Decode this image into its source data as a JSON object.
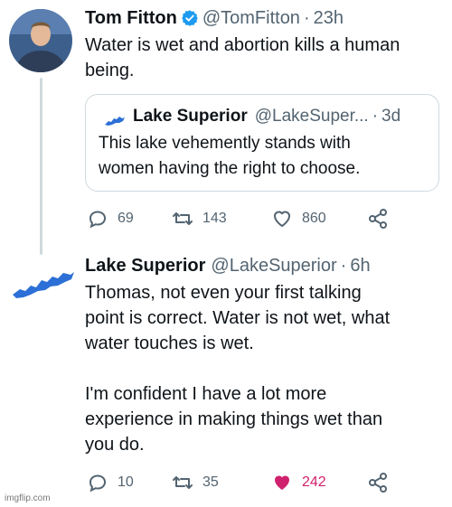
{
  "tweet1": {
    "name": "Tom Fitton",
    "handle": "@TomFitton",
    "time": "23h",
    "text": "Water is wet and abortion kills a human\nbeing.",
    "quote": {
      "name": "Lake Superior",
      "handle": "@LakeSuper...",
      "time": "3d",
      "text": "This lake vehemently stands with\nwomen having the right to choose."
    },
    "replies": "69",
    "retweets": "143",
    "likes": "860"
  },
  "tweet2": {
    "name": "Lake Superior",
    "handle": "@LakeSuperior",
    "time": "6h",
    "text": "Thomas, not even your first talking\npoint is correct. Water is not wet, what\nwater touches is wet.\n\nI'm confident I have a lot more\nexperience in making things wet than\nyou do.",
    "replies": "10",
    "retweets": "35",
    "likes": "242",
    "liked_color": "#d0216e"
  },
  "separator": "·",
  "watermark": "imgflip.com",
  "colors": {
    "verified": "#1d9bf0",
    "lake": "#2c6fd6",
    "muted": "#536471"
  }
}
